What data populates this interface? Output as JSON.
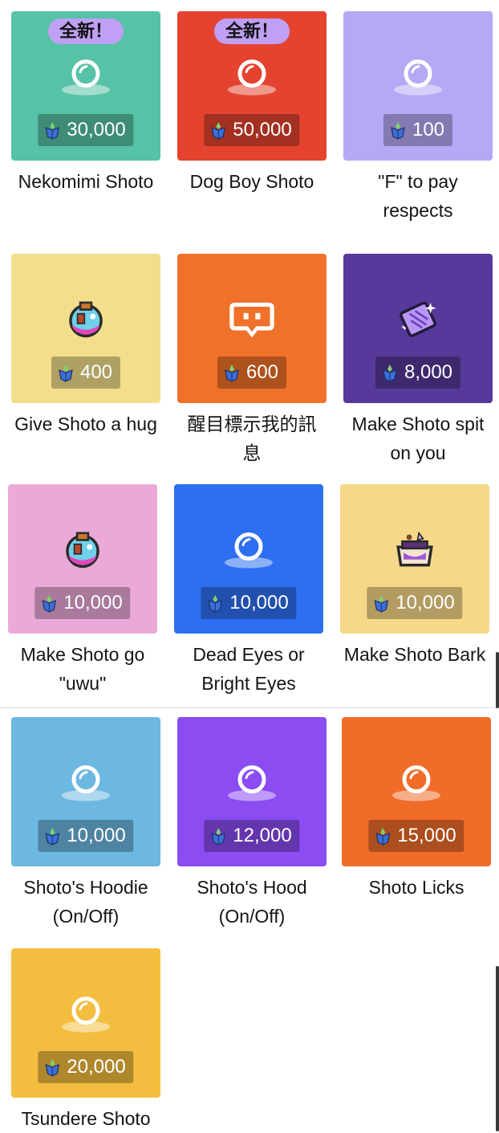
{
  "badge_text": "全新！",
  "rewards": [
    {
      "name": "Nekomimi Shoto",
      "price": "30,000",
      "color": "#56c2a6",
      "icon": "bubble-icon",
      "badge": true
    },
    {
      "name": "Dog Boy Shoto",
      "price": "50,000",
      "color": "#e3432f",
      "icon": "bubble-icon",
      "badge": true
    },
    {
      "name": "\"F\" to pay respects",
      "price": "100",
      "color": "#b7a8f6",
      "icon": "bubble-icon",
      "badge": false
    },
    {
      "name": "Give Shoto a hug",
      "price": "400",
      "color": "#f3df8b",
      "icon": "potion-icon",
      "badge": false
    },
    {
      "name": "醒目標示我的訊息",
      "price": "600",
      "color": "#f07129",
      "icon": "chat-highlight-icon",
      "badge": false
    },
    {
      "name": "Make Shoto spit on you",
      "price": "8,000",
      "color": "#56399a",
      "icon": "spell-scroll-icon",
      "badge": false
    },
    {
      "name": "Make Shoto go \"uwu\"",
      "price": "10,000",
      "color": "#eba9d7",
      "icon": "potion-icon",
      "badge": false
    },
    {
      "name": "Dead Eyes or Bright Eyes",
      "price": "10,000",
      "color": "#2e6ff1",
      "icon": "bubble-icon",
      "badge": false
    },
    {
      "name": "Make Shoto Bark",
      "price": "10,000",
      "color": "#f7d888",
      "icon": "cauldron-icon",
      "badge": false
    },
    {
      "name": "Shoto's Hoodie (On/Off)",
      "price": "10,000",
      "color": "#6db8e1",
      "icon": "bubble-icon",
      "badge": false
    },
    {
      "name": "Shoto's Hood (On/Off)",
      "price": "12,000",
      "color": "#8b4cf2",
      "icon": "bubble-icon",
      "badge": false
    },
    {
      "name": "Shoto Licks",
      "price": "15,000",
      "color": "#ef6d29",
      "icon": "bubble-icon",
      "badge": false
    },
    {
      "name": "Tsundere Shoto",
      "price": "20,000",
      "color": "#f3bd3f",
      "icon": "bubble-icon",
      "badge": false
    }
  ]
}
